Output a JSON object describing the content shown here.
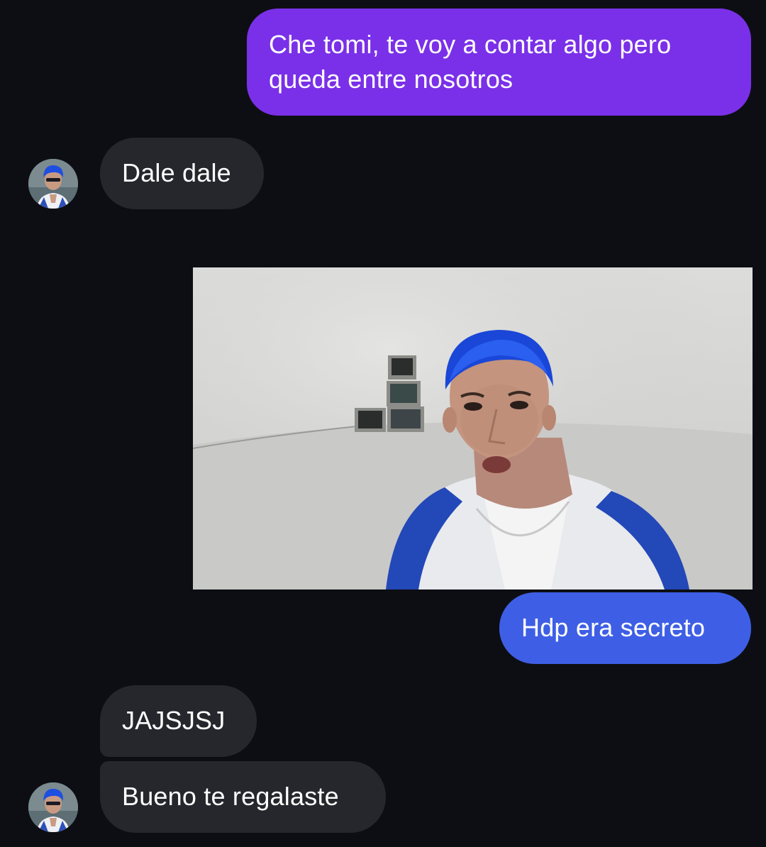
{
  "messages": [
    {
      "direction": "outgoing",
      "text": "Che tomi, te voy a contar algo pero queda entre nosotros",
      "color": "#7a30e8"
    },
    {
      "direction": "incoming",
      "text": "Dale dale",
      "color": "#26272d"
    },
    {
      "direction": "outgoing",
      "type": "image",
      "image_icon": "photo-man-blue-hair"
    },
    {
      "direction": "outgoing",
      "text": "Hdp era secreto",
      "color": "#3e5fe5"
    },
    {
      "direction": "incoming",
      "text": "JAJSJSJ",
      "color": "#26272d"
    },
    {
      "direction": "incoming",
      "text": "Bueno te regalaste",
      "color": "#26272d"
    }
  ],
  "contact": {
    "avatar_icon": "avatar-blue-hair"
  },
  "colors": {
    "background": "#0d0e14",
    "outgoing_purple": "#7a30e8",
    "outgoing_blue": "#3e5fe5",
    "incoming": "#26272d"
  }
}
